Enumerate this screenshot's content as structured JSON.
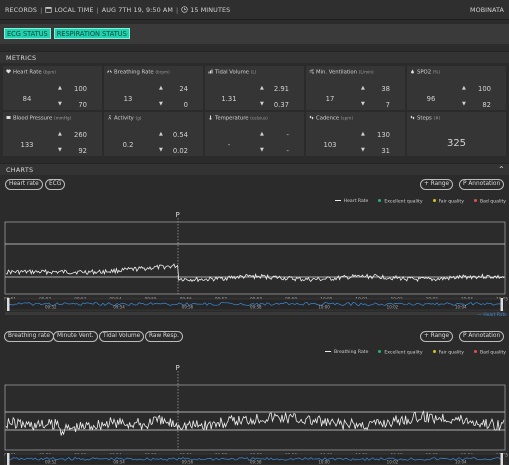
{
  "topbar": {
    "records": "RECORDS",
    "local_time": "LOCAL TIME",
    "date_time": "AUG 7TH 19, 9:50 AM",
    "duration": "15 MINUTES",
    "brand": "MOBINATA"
  },
  "status_buttons": [
    "ECG STATUS",
    "RESPIRATION STATUS"
  ],
  "sections": {
    "metrics": "METRICS",
    "charts": "CHARTS"
  },
  "metrics": {
    "heart_rate": {
      "label": "Heart Rate",
      "unit": "(bpm)",
      "avg": "84",
      "hi": "100",
      "lo": "70"
    },
    "breathing_rate": {
      "label": "Breathing Rate",
      "unit": "(brpm)",
      "avg": "13",
      "hi": "24",
      "lo": "0"
    },
    "tidal_volume": {
      "label": "Tidal Volume",
      "unit": "(L)",
      "avg": "1.31",
      "hi": "2.91",
      "lo": "0.37"
    },
    "min_ventilation": {
      "label": "Min. Ventilation",
      "unit": "(L/min)",
      "avg": "17",
      "hi": "38",
      "lo": "7"
    },
    "spo2": {
      "label": "SPO2",
      "unit": "(%)",
      "avg": "96",
      "hi": "100",
      "lo": "82"
    },
    "blood_pressure": {
      "label": "Blood Pressure",
      "unit": "(mmHg)",
      "avg": "133",
      "hi": "260",
      "lo": "92"
    },
    "activity": {
      "label": "Activity",
      "unit": "(g)",
      "avg": "0.2",
      "hi": "0.54",
      "lo": "0.02"
    },
    "temperature": {
      "label": "Temperature",
      "unit": "(celsius)",
      "avg": "-",
      "hi": "-",
      "lo": "-"
    },
    "cadence": {
      "label": "Cadence",
      "unit": "(spm)",
      "avg": "103",
      "hi": "130",
      "lo": "31"
    },
    "steps": {
      "label": "Steps",
      "unit": "(#)",
      "value": "325"
    }
  },
  "chart1": {
    "tabs": [
      "Heart rate",
      "ECG"
    ],
    "range_label": "+ Range",
    "annotation_label": "P Annotation",
    "legend": [
      "Heart Rate",
      "Excellent quality",
      "Fair quality",
      "Bad quality"
    ],
    "colors": {
      "excellent": "#22b573",
      "fair": "#d4c21a",
      "bad": "#e05050"
    },
    "marker": "P",
    "ticks": [
      "09:51",
      "09:52",
      "09:53",
      "09:54",
      "09:55",
      "09:56",
      "09:57",
      "09:58",
      "09:59",
      "10:00",
      "10:01",
      "10:02",
      "10:03",
      "10:04",
      "10:05"
    ],
    "nav_ticks": [
      "09:52",
      "09:54",
      "09:56",
      "09:58",
      "10:00",
      "10:02",
      "10:04"
    ],
    "nav_label": "Heart Rate"
  },
  "chart2": {
    "tabs": [
      "Breathing rate",
      "Minute Vent.",
      "Tidal Volume",
      "Raw Resp."
    ],
    "range_label": "+ Range",
    "annotation_label": "P Annotation",
    "legend": [
      "Breathing Rate",
      "Excellent quality",
      "Fair quality",
      "Bad quality"
    ],
    "marker": "P",
    "ticks": [
      "09:51",
      "09:52",
      "09:53",
      "09:54",
      "09:55",
      "09:56",
      "09:57",
      "09:58",
      "09:59",
      "10:00",
      "10:01",
      "10:02",
      "10:03",
      "10:04",
      "10:05"
    ],
    "nav_ticks": [
      "09:52",
      "09:54",
      "09:56",
      "09:58",
      "10:00",
      "10:02",
      "10:04"
    ]
  }
}
